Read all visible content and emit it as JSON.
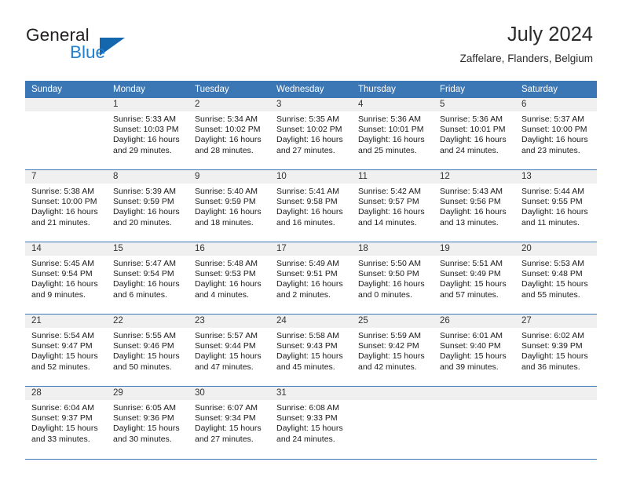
{
  "brand": {
    "name_top": "General",
    "name_bottom": "Blue",
    "triangle_color": "#1466ad",
    "blue_text_color": "#1f7fd1"
  },
  "header": {
    "title": "July 2024",
    "location": "Zaffelare, Flanders, Belgium"
  },
  "theme": {
    "header_blue": "#3c77b5",
    "date_strip": "#f0f0f0",
    "grid_line": "#3c77b5"
  },
  "weekday_headers": [
    "Sunday",
    "Monday",
    "Tuesday",
    "Wednesday",
    "Thursday",
    "Friday",
    "Saturday"
  ],
  "labels": {
    "sunrise_prefix": "Sunrise:",
    "sunset_prefix": "Sunset:",
    "daylight_prefix": "Daylight:"
  },
  "weeks": [
    [
      {
        "date": "",
        "line1": "",
        "line2": "",
        "line3": "",
        "line4": ""
      },
      {
        "date": "1",
        "line1": "Sunrise: 5:33 AM",
        "line2": "Sunset: 10:03 PM",
        "line3": "Daylight: 16 hours",
        "line4": "and 29 minutes."
      },
      {
        "date": "2",
        "line1": "Sunrise: 5:34 AM",
        "line2": "Sunset: 10:02 PM",
        "line3": "Daylight: 16 hours",
        "line4": "and 28 minutes."
      },
      {
        "date": "3",
        "line1": "Sunrise: 5:35 AM",
        "line2": "Sunset: 10:02 PM",
        "line3": "Daylight: 16 hours",
        "line4": "and 27 minutes."
      },
      {
        "date": "4",
        "line1": "Sunrise: 5:36 AM",
        "line2": "Sunset: 10:01 PM",
        "line3": "Daylight: 16 hours",
        "line4": "and 25 minutes."
      },
      {
        "date": "5",
        "line1": "Sunrise: 5:36 AM",
        "line2": "Sunset: 10:01 PM",
        "line3": "Daylight: 16 hours",
        "line4": "and 24 minutes."
      },
      {
        "date": "6",
        "line1": "Sunrise: 5:37 AM",
        "line2": "Sunset: 10:00 PM",
        "line3": "Daylight: 16 hours",
        "line4": "and 23 minutes."
      }
    ],
    [
      {
        "date": "7",
        "line1": "Sunrise: 5:38 AM",
        "line2": "Sunset: 10:00 PM",
        "line3": "Daylight: 16 hours",
        "line4": "and 21 minutes."
      },
      {
        "date": "8",
        "line1": "Sunrise: 5:39 AM",
        "line2": "Sunset: 9:59 PM",
        "line3": "Daylight: 16 hours",
        "line4": "and 20 minutes."
      },
      {
        "date": "9",
        "line1": "Sunrise: 5:40 AM",
        "line2": "Sunset: 9:59 PM",
        "line3": "Daylight: 16 hours",
        "line4": "and 18 minutes."
      },
      {
        "date": "10",
        "line1": "Sunrise: 5:41 AM",
        "line2": "Sunset: 9:58 PM",
        "line3": "Daylight: 16 hours",
        "line4": "and 16 minutes."
      },
      {
        "date": "11",
        "line1": "Sunrise: 5:42 AM",
        "line2": "Sunset: 9:57 PM",
        "line3": "Daylight: 16 hours",
        "line4": "and 14 minutes."
      },
      {
        "date": "12",
        "line1": "Sunrise: 5:43 AM",
        "line2": "Sunset: 9:56 PM",
        "line3": "Daylight: 16 hours",
        "line4": "and 13 minutes."
      },
      {
        "date": "13",
        "line1": "Sunrise: 5:44 AM",
        "line2": "Sunset: 9:55 PM",
        "line3": "Daylight: 16 hours",
        "line4": "and 11 minutes."
      }
    ],
    [
      {
        "date": "14",
        "line1": "Sunrise: 5:45 AM",
        "line2": "Sunset: 9:54 PM",
        "line3": "Daylight: 16 hours",
        "line4": "and 9 minutes."
      },
      {
        "date": "15",
        "line1": "Sunrise: 5:47 AM",
        "line2": "Sunset: 9:54 PM",
        "line3": "Daylight: 16 hours",
        "line4": "and 6 minutes."
      },
      {
        "date": "16",
        "line1": "Sunrise: 5:48 AM",
        "line2": "Sunset: 9:53 PM",
        "line3": "Daylight: 16 hours",
        "line4": "and 4 minutes."
      },
      {
        "date": "17",
        "line1": "Sunrise: 5:49 AM",
        "line2": "Sunset: 9:51 PM",
        "line3": "Daylight: 16 hours",
        "line4": "and 2 minutes."
      },
      {
        "date": "18",
        "line1": "Sunrise: 5:50 AM",
        "line2": "Sunset: 9:50 PM",
        "line3": "Daylight: 16 hours",
        "line4": "and 0 minutes."
      },
      {
        "date": "19",
        "line1": "Sunrise: 5:51 AM",
        "line2": "Sunset: 9:49 PM",
        "line3": "Daylight: 15 hours",
        "line4": "and 57 minutes."
      },
      {
        "date": "20",
        "line1": "Sunrise: 5:53 AM",
        "line2": "Sunset: 9:48 PM",
        "line3": "Daylight: 15 hours",
        "line4": "and 55 minutes."
      }
    ],
    [
      {
        "date": "21",
        "line1": "Sunrise: 5:54 AM",
        "line2": "Sunset: 9:47 PM",
        "line3": "Daylight: 15 hours",
        "line4": "and 52 minutes."
      },
      {
        "date": "22",
        "line1": "Sunrise: 5:55 AM",
        "line2": "Sunset: 9:46 PM",
        "line3": "Daylight: 15 hours",
        "line4": "and 50 minutes."
      },
      {
        "date": "23",
        "line1": "Sunrise: 5:57 AM",
        "line2": "Sunset: 9:44 PM",
        "line3": "Daylight: 15 hours",
        "line4": "and 47 minutes."
      },
      {
        "date": "24",
        "line1": "Sunrise: 5:58 AM",
        "line2": "Sunset: 9:43 PM",
        "line3": "Daylight: 15 hours",
        "line4": "and 45 minutes."
      },
      {
        "date": "25",
        "line1": "Sunrise: 5:59 AM",
        "line2": "Sunset: 9:42 PM",
        "line3": "Daylight: 15 hours",
        "line4": "and 42 minutes."
      },
      {
        "date": "26",
        "line1": "Sunrise: 6:01 AM",
        "line2": "Sunset: 9:40 PM",
        "line3": "Daylight: 15 hours",
        "line4": "and 39 minutes."
      },
      {
        "date": "27",
        "line1": "Sunrise: 6:02 AM",
        "line2": "Sunset: 9:39 PM",
        "line3": "Daylight: 15 hours",
        "line4": "and 36 minutes."
      }
    ],
    [
      {
        "date": "28",
        "line1": "Sunrise: 6:04 AM",
        "line2": "Sunset: 9:37 PM",
        "line3": "Daylight: 15 hours",
        "line4": "and 33 minutes."
      },
      {
        "date": "29",
        "line1": "Sunrise: 6:05 AM",
        "line2": "Sunset: 9:36 PM",
        "line3": "Daylight: 15 hours",
        "line4": "and 30 minutes."
      },
      {
        "date": "30",
        "line1": "Sunrise: 6:07 AM",
        "line2": "Sunset: 9:34 PM",
        "line3": "Daylight: 15 hours",
        "line4": "and 27 minutes."
      },
      {
        "date": "31",
        "line1": "Sunrise: 6:08 AM",
        "line2": "Sunset: 9:33 PM",
        "line3": "Daylight: 15 hours",
        "line4": "and 24 minutes."
      },
      {
        "date": "",
        "line1": "",
        "line2": "",
        "line3": "",
        "line4": ""
      },
      {
        "date": "",
        "line1": "",
        "line2": "",
        "line3": "",
        "line4": ""
      },
      {
        "date": "",
        "line1": "",
        "line2": "",
        "line3": "",
        "line4": ""
      }
    ]
  ]
}
